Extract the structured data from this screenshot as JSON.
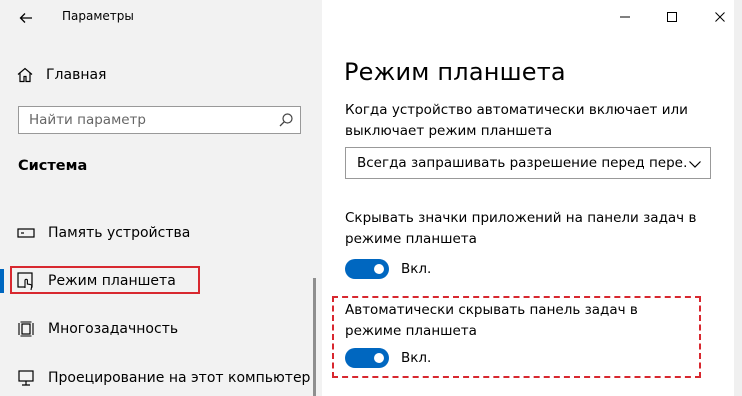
{
  "window": {
    "back_icon": "back-arrow-icon",
    "title": "Параметры",
    "controls": [
      "minimize-icon",
      "maximize-icon",
      "close-icon"
    ]
  },
  "sidebar": {
    "home": {
      "label": "Главная",
      "icon": "home-icon"
    },
    "search": {
      "placeholder": "Найти параметр",
      "value": "",
      "icon": "search-icon"
    },
    "section_title": "Система",
    "items": [
      {
        "label": "Память устройства",
        "icon": "storage-icon",
        "selected": false
      },
      {
        "label": "Режим планшета",
        "icon": "tablet-mode-icon",
        "selected": true
      },
      {
        "label": "Многозадачность",
        "icon": "multitasking-icon",
        "selected": false
      },
      {
        "label": "Проецирование на этот компьютер",
        "icon": "projecting-icon",
        "selected": false
      }
    ]
  },
  "main": {
    "page_title": "Режим планшета",
    "setting1": {
      "description": "Когда устройство автоматически включает или выключает режим планшета",
      "dropdown_value": "Всегда запрашивать разрешение перед пере…"
    },
    "setting2": {
      "description": "Скрывать значки приложений на панели задач в режиме планшета",
      "toggle_label": "Вкл.",
      "toggle_on": true
    },
    "setting3": {
      "description": "Автоматически скрывать панель задач в режиме планшета",
      "toggle_label": "Вкл.",
      "toggle_on": true
    }
  },
  "colors": {
    "accent": "#0067c0",
    "highlight": "#d8282f",
    "sidebar_bg": "#f2f2f2"
  }
}
